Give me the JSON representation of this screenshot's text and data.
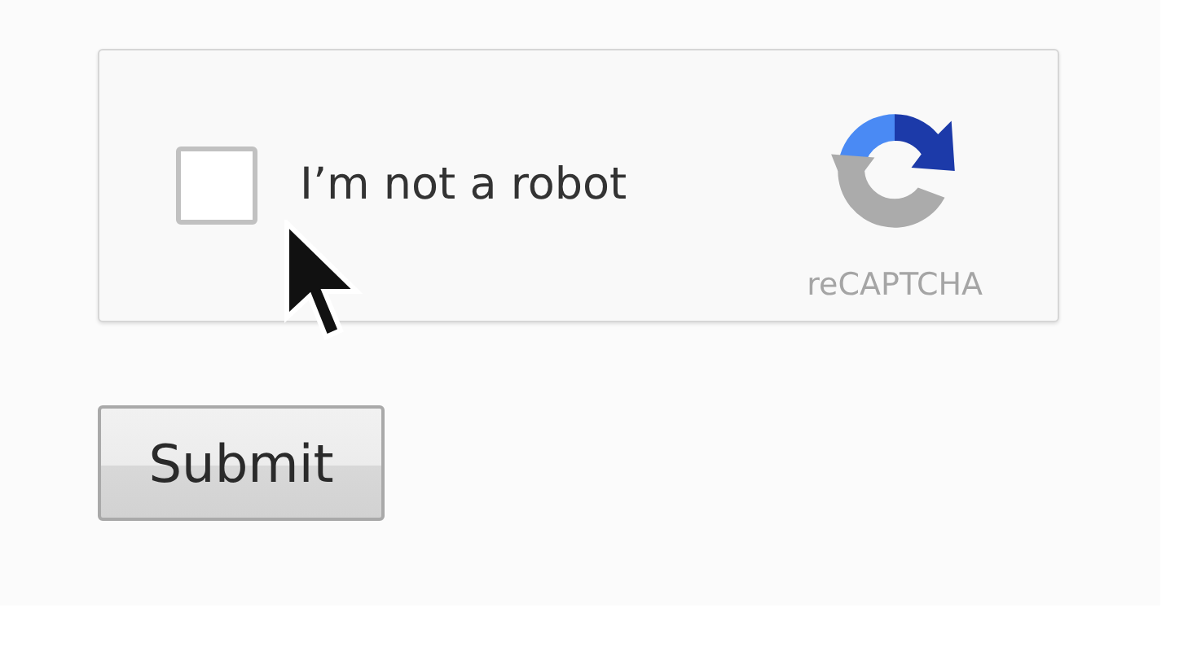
{
  "captcha": {
    "checkbox": {
      "checked": false
    },
    "label": "I’m not a robot",
    "brand": "reCAPTCHA"
  },
  "submit": {
    "label": "Submit"
  }
}
